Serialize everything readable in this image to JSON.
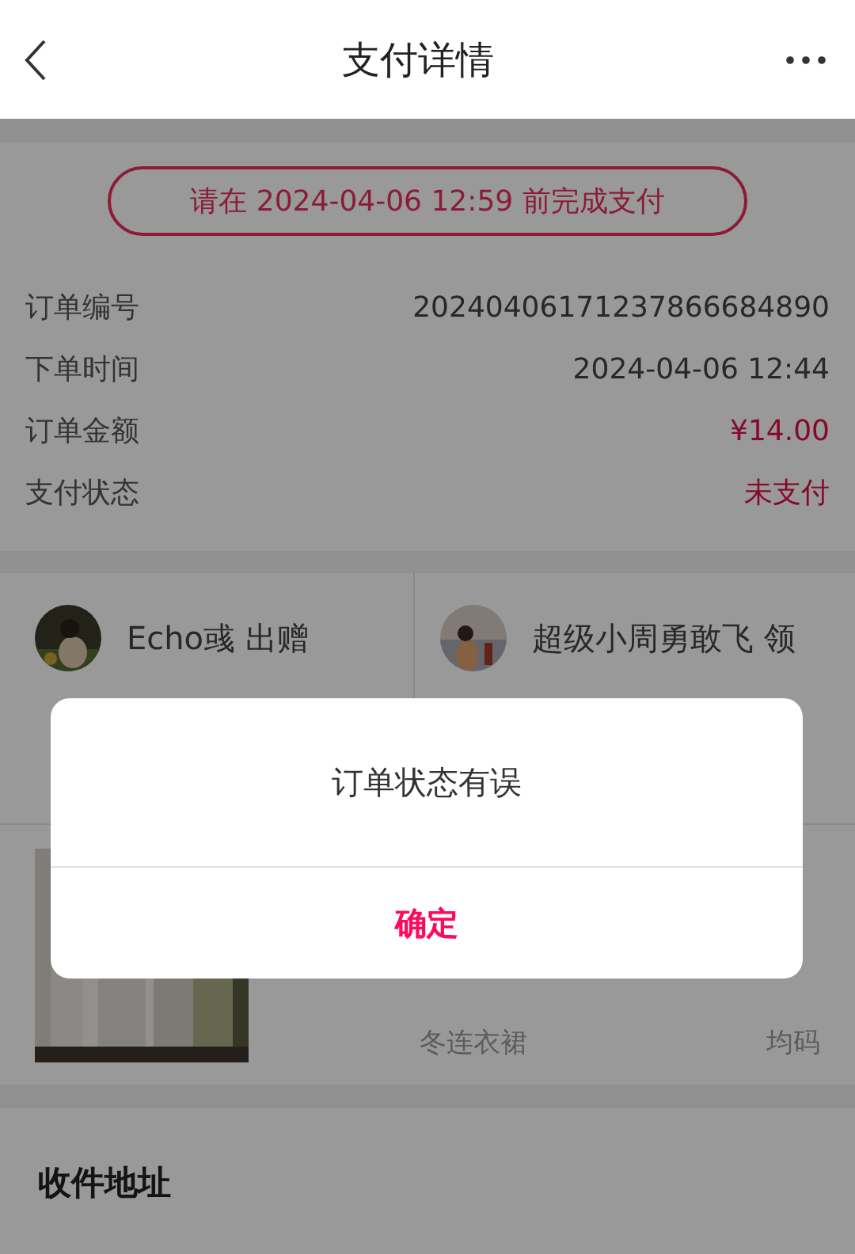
{
  "header": {
    "title": "支付详情"
  },
  "deadline": "请在 2024-04-06 12:59 前完成支付",
  "order_fields": [
    {
      "label": "订单编号",
      "value": "20240406171237866684890",
      "highlight": false
    },
    {
      "label": "下单时间",
      "value": "2024-04-06 12:44",
      "highlight": false
    },
    {
      "label": "订单金额",
      "value": "¥14.00",
      "highlight": true
    },
    {
      "label": "支付状态",
      "value": "未支付",
      "highlight": true
    }
  ],
  "participants": [
    {
      "name": "Echo彧 出赠"
    },
    {
      "name": "超级小周勇敢飞 领"
    }
  ],
  "product": {
    "name": "冬连衣裙",
    "size": "均码"
  },
  "address": {
    "title": "收件地址"
  },
  "dialog": {
    "message": "订单状态有误",
    "button": "确定"
  }
}
